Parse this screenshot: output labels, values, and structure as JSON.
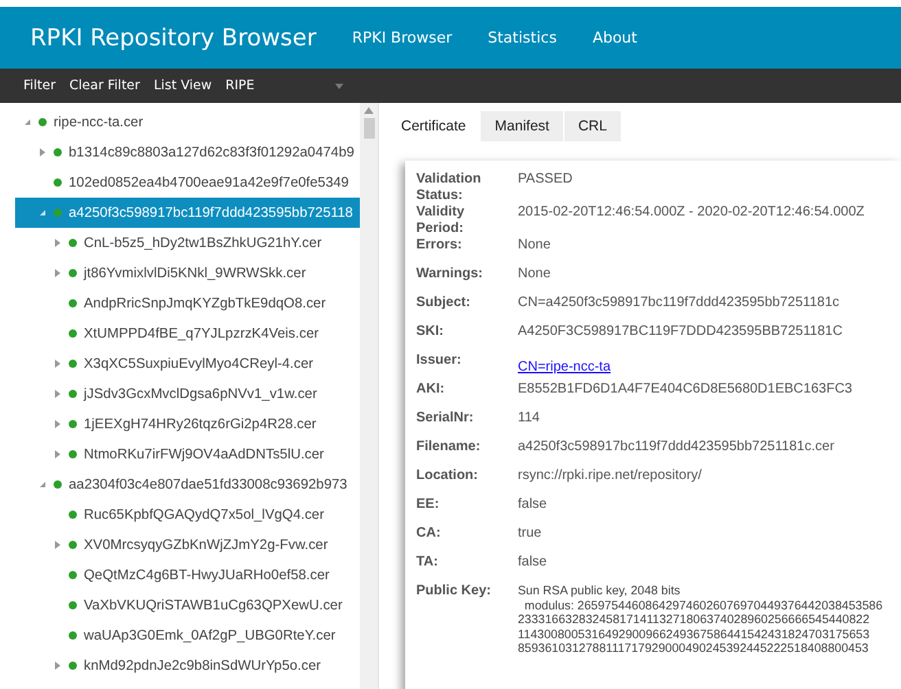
{
  "header": {
    "title": "RPKI Repository Browser",
    "nav": [
      {
        "label": "RPKI Browser"
      },
      {
        "label": "Statistics"
      },
      {
        "label": "About"
      }
    ]
  },
  "toolbar": {
    "buttons": [
      "Filter",
      "Clear Filter",
      "List View"
    ],
    "repository": {
      "value": "RIPE"
    }
  },
  "tree": [
    {
      "label": "ripe-ncc-ta.cer",
      "kind": "branch",
      "expanded": true,
      "selected": false,
      "children": [
        {
          "label": "b1314c89c8803a127d62c83f3f01292a0474b9",
          "kind": "branch",
          "expanded": false,
          "selected": false
        },
        {
          "label": "102ed0852ea4b4700eae91a42e9f7e0fe5349",
          "kind": "leaf",
          "selected": false
        },
        {
          "label": "a4250f3c598917bc119f7ddd423595bb725118",
          "kind": "branch",
          "expanded": true,
          "selected": true,
          "children": [
            {
              "label": "CnL-b5z5_hDy2tw1BsZhkUG21hY.cer",
              "kind": "branch",
              "expanded": false,
              "selected": false
            },
            {
              "label": "jt86YvmixlvlDi5KNkl_9WRWSkk.cer",
              "kind": "branch",
              "expanded": false,
              "selected": false
            },
            {
              "label": "AndpRricSnpJmqKYZgbTkE9dqO8.cer",
              "kind": "leaf",
              "selected": false
            },
            {
              "label": "XtUMPPD4fBE_q7YJLpzrzK4Veis.cer",
              "kind": "leaf",
              "selected": false
            },
            {
              "label": "X3qXC5SuxpiuEvylMyo4CReyl-4.cer",
              "kind": "branch",
              "expanded": false,
              "selected": false
            },
            {
              "label": "jJSdv3GcxMvclDgsa6pNVv1_v1w.cer",
              "kind": "branch",
              "expanded": false,
              "selected": false
            },
            {
              "label": "1jEEXgH74HRy26tqz6rGi2p4R28.cer",
              "kind": "branch",
              "expanded": false,
              "selected": false
            },
            {
              "label": "NtmoRKu7irFWj9OV4aAdDNTs5lU.cer",
              "kind": "branch",
              "expanded": false,
              "selected": false
            }
          ]
        },
        {
          "label": "aa2304f03c4e807dae51fd33008c93692b973",
          "kind": "branch",
          "expanded": true,
          "selected": false,
          "children": [
            {
              "label": "Ruc65KpbfQGAQydQ7x5ol_lVgQ4.cer",
              "kind": "leaf",
              "selected": false
            },
            {
              "label": "XV0MrcsyqyGZbKnWjZJmY2g-Fvw.cer",
              "kind": "branch",
              "expanded": false,
              "selected": false
            },
            {
              "label": "QeQtMzC4g6BT-HwyJUaRHo0ef58.cer",
              "kind": "leaf",
              "selected": false
            },
            {
              "label": "VaXbVKUQriSTAWB1uCg63QPXewU.cer",
              "kind": "leaf",
              "selected": false
            },
            {
              "label": "waUAp3G0Emk_0Af2gP_UBG0RteY.cer",
              "kind": "leaf",
              "selected": false
            },
            {
              "label": "knMd92pdnJe2c9b8inSdWUrYp5o.cer",
              "kind": "branch",
              "expanded": false,
              "selected": false
            }
          ]
        }
      ]
    }
  ],
  "tabs": [
    {
      "label": "Certificate",
      "selected": true
    },
    {
      "label": "Manifest",
      "selected": false
    },
    {
      "label": "CRL",
      "selected": false
    }
  ],
  "details": [
    {
      "label": "Validation Status:",
      "value": "PASSED",
      "kind": "text"
    },
    {
      "label": "Validity Period:",
      "value": "2015-02-20T12:46:54.000Z - 2020-02-20T12:46:54.000Z",
      "kind": "text"
    },
    {
      "label": "Errors:",
      "value": "None",
      "kind": "text"
    },
    {
      "label": "Warnings:",
      "value": "None",
      "kind": "text"
    },
    {
      "label": "Subject:",
      "value": "CN=a4250f3c598917bc119f7ddd423595bb7251181c",
      "kind": "text"
    },
    {
      "label": "SKI:",
      "value": "A4250F3C598917BC119F7DDD423595BB7251181C",
      "kind": "text"
    },
    {
      "label": "Issuer:",
      "value": "CN=ripe-ncc-ta",
      "kind": "link"
    },
    {
      "label": "AKI:",
      "value": "E8552B1FD6D1A4F7E404C6D8E5680D1EBC163FC3",
      "kind": "text"
    },
    {
      "label": "SerialNr:",
      "value": "114",
      "kind": "text"
    },
    {
      "label": "Filename:",
      "value": "a4250f3c598917bc119f7ddd423595bb7251181c.cer",
      "kind": "text"
    },
    {
      "label": "Location:",
      "value": "rsync://rpki.ripe.net/repository/",
      "kind": "text"
    },
    {
      "label": "EE:",
      "value": "false",
      "kind": "text"
    },
    {
      "label": "CA:",
      "value": "true",
      "kind": "text"
    },
    {
      "label": "TA:",
      "value": "false",
      "kind": "text"
    },
    {
      "label": "Public Key:",
      "kind": "key",
      "lines": [
        "Sun RSA public key, 2048 bits",
        "  modulus: 265975446086429746026076970449376442038453586",
        "2333166328324581714113271806374028960256666545440822",
        "1143008005316492900966249367586441542431824703175653",
        "8593610312788111717929000490245392445222518408800453"
      ]
    }
  ]
}
